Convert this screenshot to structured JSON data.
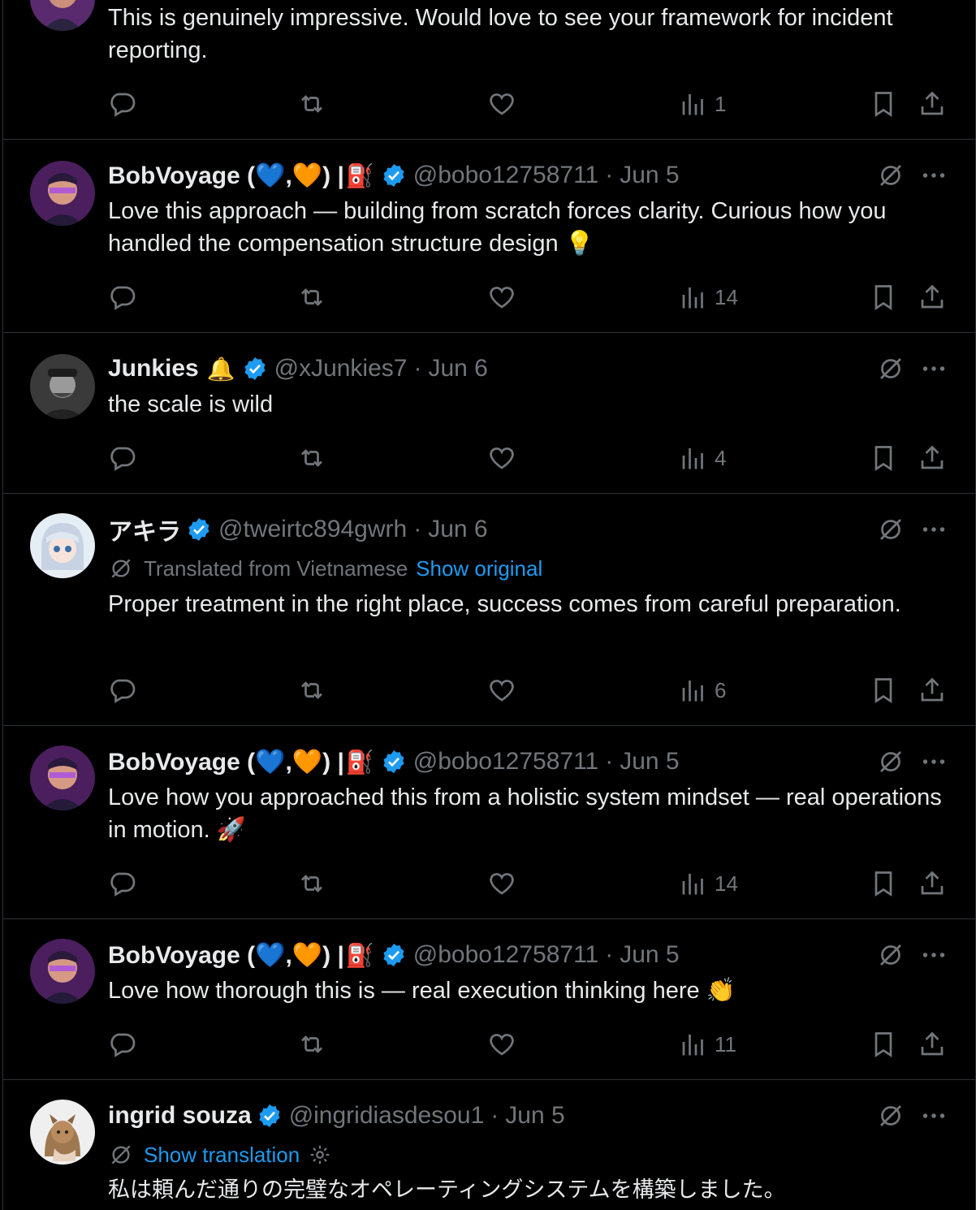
{
  "posts": [
    {
      "text": "This is genuinely impressive. Would love to see your framework for incident reporting.",
      "views": "1"
    },
    {
      "display_name": "BobVoyage (💙,🧡) |",
      "emoji": "⛽",
      "handle": "@bobo12758711",
      "separator": "·",
      "date": "Jun 5",
      "text": "Love this approach — building from scratch forces clarity. Curious how you handled the compensation structure design 💡",
      "views": "14"
    },
    {
      "display_name": "Junkies",
      "emoji": "🔔",
      "handle": "@xJunkies7",
      "separator": "·",
      "date": "Jun 6",
      "text": "the scale is wild",
      "views": "4"
    },
    {
      "display_name": "アキラ",
      "handle": "@tweirtc894gwrh",
      "separator": "·",
      "date": "Jun 6",
      "translated_label": "Translated from Vietnamese",
      "show_original": "Show original",
      "text": "Proper treatment in the right place, success comes from careful preparation.",
      "views": "6"
    },
    {
      "display_name": "BobVoyage (💙,🧡) |",
      "emoji": "⛽",
      "handle": "@bobo12758711",
      "separator": "·",
      "date": "Jun 5",
      "text": "Love how you approached this from a holistic system mindset — real operations in motion. 🚀",
      "views": "14"
    },
    {
      "display_name": "BobVoyage (💙,🧡) |",
      "emoji": "⛽",
      "handle": "@bobo12758711",
      "separator": "·",
      "date": "Jun 5",
      "text": "Love how thorough this is — real execution thinking here 👏",
      "views": "11"
    },
    {
      "display_name": "ingrid souza",
      "handle": "@ingridiasdesou1",
      "separator": "·",
      "date": "Jun 5",
      "show_translation": "Show translation",
      "text": "私は頼んだ通りの完璧なオペレーティングシステムを構築しました。"
    }
  ],
  "icons": {
    "reply": "reply-icon",
    "retweet": "retweet-icon",
    "like": "like-icon",
    "views": "views-icon",
    "bookmark": "bookmark-icon",
    "share": "share-icon",
    "grok": "grok-icon",
    "more": "more-icon",
    "verified": "verified-badge-icon"
  },
  "colors": {
    "background": "#000000",
    "text": "#e7e9ea",
    "muted": "#71767b",
    "link": "#1d9bf0",
    "divider": "#2f3336",
    "verified": "#1d9bf0"
  }
}
